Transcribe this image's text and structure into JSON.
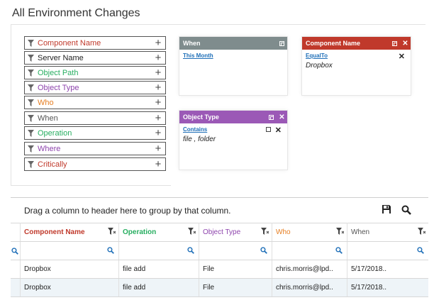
{
  "page": {
    "title": "All Environment Changes"
  },
  "filters": [
    {
      "label": "Component Name",
      "color": "#c0392b"
    },
    {
      "label": "Server Name",
      "color": "#222222"
    },
    {
      "label": "Object Path",
      "color": "#27ae60"
    },
    {
      "label": "Object Type",
      "color": "#8e44ad"
    },
    {
      "label": "Who",
      "color": "#e67e22"
    },
    {
      "label": "When",
      "color": "#555555"
    },
    {
      "label": "Operation",
      "color": "#27ae60"
    },
    {
      "label": "Where",
      "color": "#8e44ad"
    },
    {
      "label": "Critically",
      "color": "#c0392b"
    }
  ],
  "panels": {
    "when": {
      "title": "When",
      "color": "#7f8c8d",
      "value": "This Month"
    },
    "component": {
      "title": "Component Name",
      "color": "#c0392b",
      "operator": "EqualTo",
      "value": "Dropbox"
    },
    "object_type": {
      "title": "Object Type",
      "color": "#9b59b6",
      "operator": "Contains",
      "value": "file , folder"
    }
  },
  "grid": {
    "group_hint": "Drag a column to header here to group by that column.",
    "columns": [
      {
        "label": "Component Name",
        "color": "#c0392b"
      },
      {
        "label": "Operation",
        "color": "#27ae60"
      },
      {
        "label": "Object Type",
        "color": "#8e44ad"
      },
      {
        "label": "Who",
        "color": "#e67e22"
      },
      {
        "label": "When",
        "color": "#555555"
      }
    ],
    "rows": [
      [
        "Dropbox",
        "file add",
        "File",
        "chris.morris@lpd..",
        "5/17/2018.."
      ],
      [
        "Dropbox",
        "file add",
        "File",
        "chris.morris@lpd..",
        "5/17/2018.."
      ]
    ]
  }
}
